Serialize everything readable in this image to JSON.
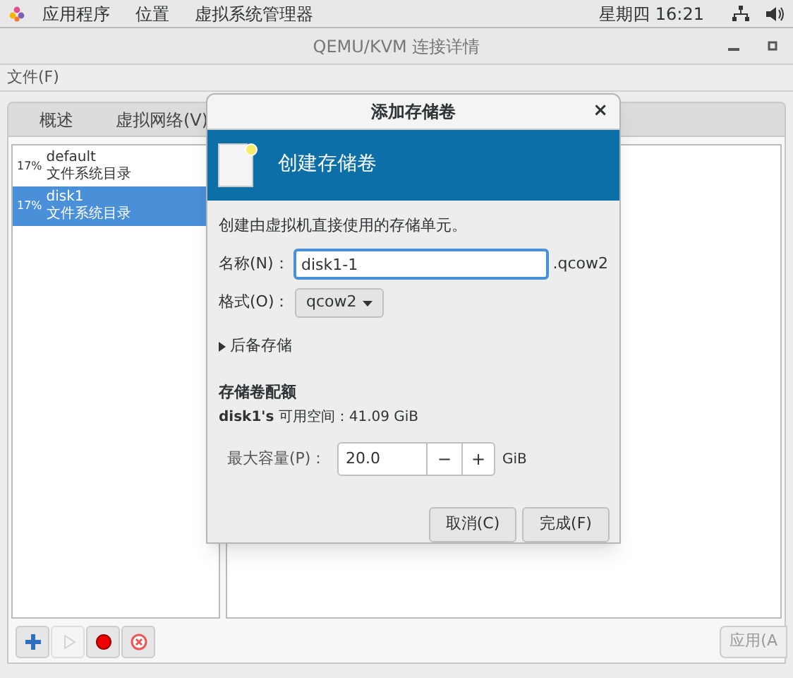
{
  "top_bar": {
    "menus": [
      "应用程序",
      "位置",
      "虚拟系统管理器"
    ],
    "clock": "星期四 16:21"
  },
  "window": {
    "title": "QEMU/KVM 连接详情"
  },
  "menu_bar": [
    "文件(F)"
  ],
  "tabs": [
    {
      "label": "概述",
      "selected": false
    },
    {
      "label": "虚拟网络(V)",
      "selected": false
    }
  ],
  "pools": [
    {
      "usage": "17%",
      "name": "default",
      "type": "文件系统目录",
      "selected": false
    },
    {
      "usage": "17%",
      "name": "disk1",
      "type": "文件系统目录",
      "selected": true
    }
  ],
  "toolbar": [
    {
      "kind": "add",
      "disabled": false
    },
    {
      "kind": "start",
      "disabled": true
    },
    {
      "kind": "stop",
      "disabled": false
    },
    {
      "kind": "delete",
      "disabled": false
    }
  ],
  "apply_button": "应用(A",
  "dialog": {
    "title": "添加存储卷",
    "close": "×",
    "header": "创建存储卷",
    "description": "创建由虚拟机直接使用的存储单元。",
    "name_label": "名称(N)：",
    "name_value": "disk1-1",
    "name_suffix": ".qcow2",
    "format_label": "格式(O)：",
    "format_value": "qcow2",
    "backing": {
      "label": "后备存储",
      "expanded": false
    },
    "quota_title": "存储卷配额",
    "available": "**disk1's** 可用空间：41.09 GiB",
    "capacity_label": "最大容量(P)：",
    "capacity_value": "20.0",
    "decrement": "−",
    "increment": "+",
    "capacity_unit": "GiB",
    "buttons": [
      "取消(C)",
      "完成(F)"
    ]
  }
}
